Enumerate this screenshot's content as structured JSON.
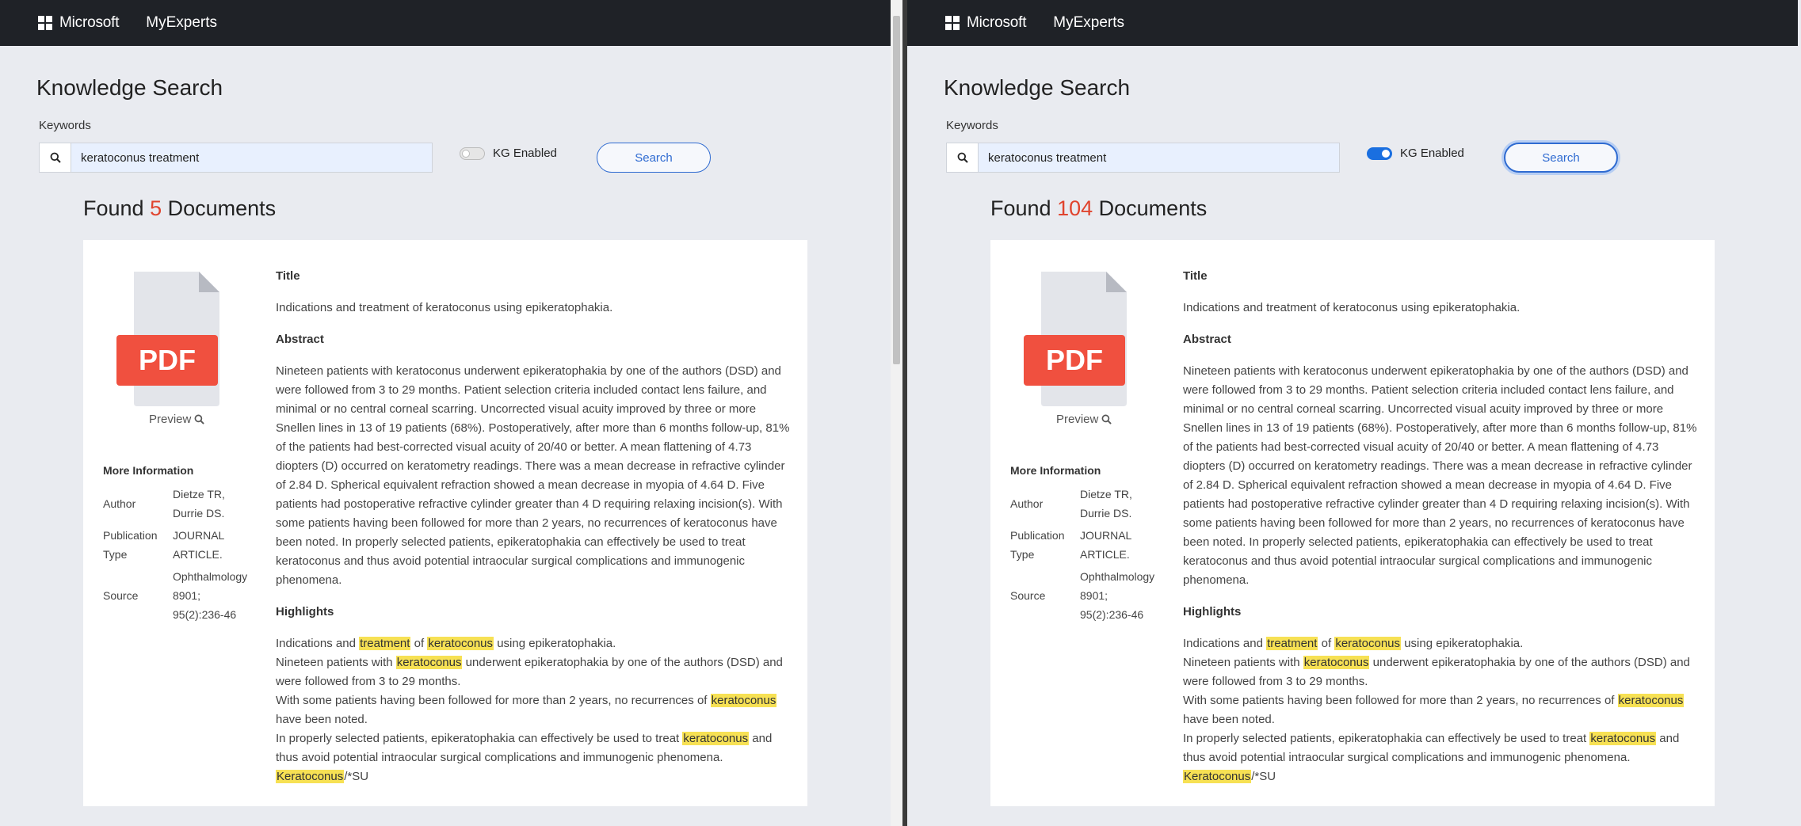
{
  "panes": [
    {
      "header": {
        "brand": "Microsoft",
        "app_name": "MyExperts"
      },
      "page_title": "Knowledge Search",
      "keywords_label": "Keywords",
      "search": {
        "value": "keratoconus treatment"
      },
      "kg_toggle": {
        "label": "KG Enabled",
        "enabled": false
      },
      "search_button": "Search",
      "found": {
        "prefix": "Found",
        "count": "5",
        "suffix": "Documents"
      }
    },
    {
      "header": {
        "brand": "Microsoft",
        "app_name": "MyExperts"
      },
      "page_title": "Knowledge Search",
      "keywords_label": "Keywords",
      "search": {
        "value": "keratoconus treatment"
      },
      "kg_toggle": {
        "label": "KG Enabled",
        "enabled": true
      },
      "search_button": "Search",
      "found": {
        "prefix": "Found",
        "count": "104",
        "suffix": "Documents"
      }
    }
  ],
  "document": {
    "pdf_label": "PDF",
    "preview_label": "Preview",
    "more_info_heading": "More Information",
    "info": [
      {
        "key": "Author",
        "value": "Dietze TR, Durrie DS."
      },
      {
        "key": "Publication Type",
        "value": "JOURNAL ARTICLE."
      },
      {
        "key": "Source",
        "value": "Ophthalmology 8901; 95(2):236-46"
      }
    ],
    "title_heading": "Title",
    "title": "Indications and treatment of keratoconus using epikeratophakia.",
    "abstract_heading": "Abstract",
    "abstract": "Nineteen patients with keratoconus underwent epikeratophakia by one of the authors (DSD) and were followed from 3 to 29 months. Patient selection criteria included contact lens failure, and minimal or no central corneal scarring. Uncorrected visual acuity improved by three or more Snellen lines in 13 of 19 patients (68%). Postoperatively, after more than 6 months follow-up, 81% of the patients had best-corrected visual acuity of 20/40 or better. A mean flattening of 4.73 diopters (D) occurred on keratometry readings. There was a mean decrease in refractive cylinder of 2.84 D. Spherical equivalent refraction showed a mean decrease in myopia of 4.64 D. Five patients had postoperative refractive cylinder greater than 4 D requiring relaxing incision(s). With some patients having been followed for more than 2 years, no recurrences of keratoconus have been noted. In properly selected patients, epikeratophakia can effectively be used to treat keratoconus and thus avoid potential intraocular surgical complications and immunogenic phenomena.",
    "highlights_heading": "Highlights",
    "highlights": [
      [
        {
          "t": "Indications and "
        },
        {
          "t": "treatment",
          "h": true
        },
        {
          "t": " of "
        },
        {
          "t": "keratoconus",
          "h": true
        },
        {
          "t": " using epikeratophakia."
        }
      ],
      [
        {
          "t": "Nineteen patients with "
        },
        {
          "t": "keratoconus",
          "h": true
        },
        {
          "t": " underwent epikeratophakia by one of the authors (DSD) and were followed from 3 to 29 months."
        }
      ],
      [
        {
          "t": "With some patients having been followed for more than 2 years, no recurrences of "
        },
        {
          "t": "keratoconus",
          "h": true
        },
        {
          "t": " have been noted."
        }
      ],
      [
        {
          "t": "In properly selected patients, epikeratophakia can effectively be used to treat "
        },
        {
          "t": "keratoconus",
          "h": true
        },
        {
          "t": " and thus avoid potential intraocular surgical complications and immunogenic phenomena."
        }
      ],
      [
        {
          "t": "Keratoconus",
          "h": true
        },
        {
          "t": "/*SU"
        }
      ]
    ]
  },
  "colors": {
    "header_bg": "#1f2227",
    "accent": "#2f6bd1",
    "count": "#e0442e",
    "highlight": "#f7e154",
    "pdf_red": "#f0503f"
  }
}
